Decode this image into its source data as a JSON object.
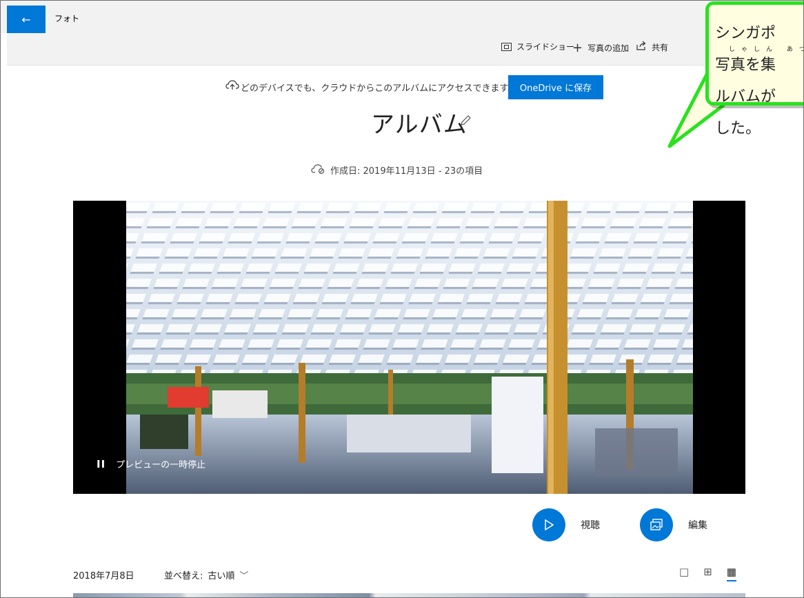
{
  "titlebar": {
    "app_title": "フォト",
    "back_icon": "←"
  },
  "toolbar": {
    "slideshow_label": "スライドショー",
    "add_photos_label": "写真の追加",
    "share_label": "共有"
  },
  "cloud_banner": {
    "text": "どのデバイスでも、クラウドからこのアルバムにアクセスできます。",
    "button_label": "OneDrive に保存"
  },
  "album": {
    "title": "アルバム",
    "meta": "作成日: 2019年11月13日 - 23の項目"
  },
  "video": {
    "pause_label": "プレビューの一時停止"
  },
  "actions": {
    "watch_label": "視聴",
    "edit_label": "編集"
  },
  "bottom": {
    "date": "2018年7月8日",
    "sort_label": "並べ替え:",
    "sort_value": "古い順"
  },
  "callout": {
    "line1": "シンガポ",
    "line2": "写真を集",
    "line3": "ルバムが",
    "line4": "した。",
    "ruby": "しゃしん あつ"
  },
  "colors": {
    "accent": "#0078d7",
    "callout_border": "#28e21e",
    "callout_fill": "#fffee0"
  }
}
